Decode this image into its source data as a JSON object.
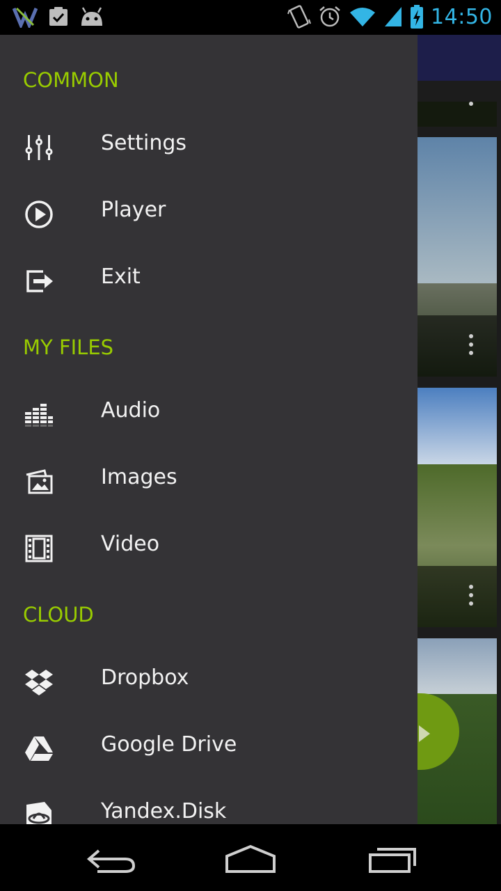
{
  "status_bar": {
    "time": "14:50",
    "left_icons": [
      "app-x-icon",
      "clipboard-check-icon",
      "android-icon"
    ],
    "right_icons": [
      "vibrate-icon",
      "alarm-icon",
      "wifi-icon",
      "signal-icon",
      "battery-charging-icon"
    ]
  },
  "drawer": {
    "sections": [
      {
        "header": "COMMON",
        "items": [
          {
            "label": "Settings",
            "icon": "settings-sliders-icon"
          },
          {
            "label": "Player",
            "icon": "play-circle-icon"
          },
          {
            "label": "Exit",
            "icon": "exit-icon"
          }
        ]
      },
      {
        "header": "MY FILES",
        "items": [
          {
            "label": "Audio",
            "icon": "equalizer-icon"
          },
          {
            "label": "Images",
            "icon": "images-icon"
          },
          {
            "label": "Video",
            "icon": "film-icon"
          }
        ]
      },
      {
        "header": "CLOUD",
        "items": [
          {
            "label": "Dropbox",
            "icon": "dropbox-icon"
          },
          {
            "label": "Google Drive",
            "icon": "google-drive-icon"
          },
          {
            "label": "Yandex.Disk",
            "icon": "yandex-disk-icon"
          }
        ]
      }
    ]
  },
  "nav_bar": {
    "buttons": [
      "back-icon",
      "home-icon",
      "recents-icon"
    ]
  },
  "colors": {
    "accent": "#99cc00",
    "drawer_bg": "#343336",
    "clock": "#33b5e5",
    "fab": "#6f9a12"
  }
}
